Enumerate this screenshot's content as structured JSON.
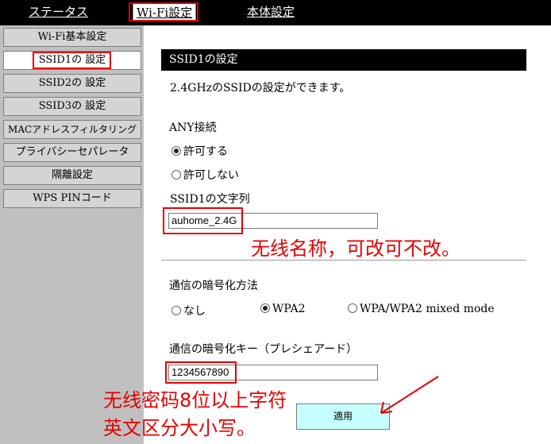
{
  "top_nav": {
    "status": "ステータス",
    "wifi": "Wi-Fi設定",
    "device": "本体設定"
  },
  "sidebar": {
    "items": [
      "Wi-Fi基本設定",
      "SSID1の 設定",
      "SSID2の 設定",
      "SSID3の 設定",
      "MACアドレスフィルタリング",
      "プライバシーセパレータ",
      "隔離設定",
      "WPS PINコード"
    ]
  },
  "main": {
    "section_title": "SSID1の設定",
    "description": "2.4GHzのSSIDの設定ができます。",
    "any_label": "ANY接続",
    "any_allow": "許可する",
    "any_deny": "許可しない",
    "ssid_label": "SSID1の文字列",
    "ssid_value": "auhome_2.4G",
    "enc_label": "通信の暗号化方法",
    "enc_none": "なし",
    "enc_wpa2": "WPA2",
    "enc_mixed": "WPA/WPA2 mixed mode",
    "key_label": "通信の暗号化キー（プレシェアード）",
    "key_value": "1234567890",
    "apply_label": "適用"
  },
  "annotations": {
    "ssid_note": "无线名称，可改可不改。",
    "key_note_line1": "无线密码8位以上字符",
    "key_note_line2": "英文区分大小写。",
    "color": "#e60000"
  }
}
